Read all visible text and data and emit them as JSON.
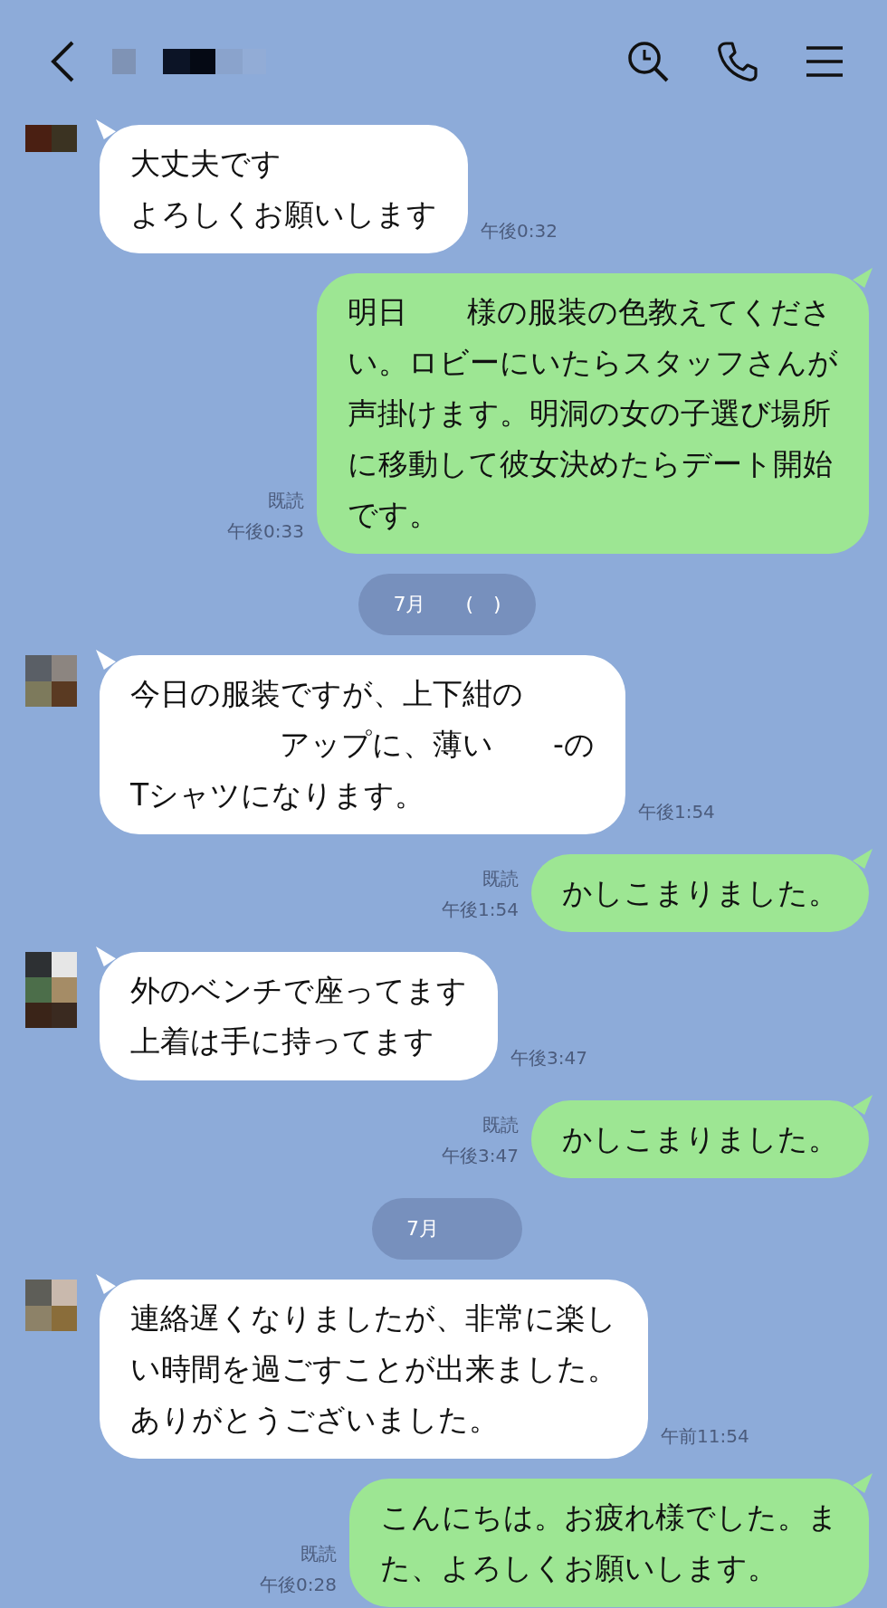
{
  "messages": [
    {
      "kind": "incoming",
      "lines": [
        "大丈夫です",
        "よろしくお願いします"
      ],
      "time": "午後0:32"
    },
    {
      "kind": "outgoing",
      "lines": [
        "明日　　様の服装の色教えてくださ",
        "い。ロビーにいたらスタッフさんが",
        "声掛けます。明洞の女の子選び場所",
        "に移動して彼女決めたらデート開始",
        "です。"
      ],
      "read_receipt": "既読",
      "time": "午後0:33"
    },
    {
      "kind": "date",
      "text": "7月　　(　)"
    },
    {
      "kind": "incoming",
      "lines": [
        "今日の服装ですが、上下紺の",
        "　　　　　アップに、薄い　　-の",
        "Tシャツになります。"
      ],
      "time": "午後1:54"
    },
    {
      "kind": "outgoing",
      "lines": [
        "かしこまりました。"
      ],
      "read_receipt": "既読",
      "time": "午後1:54"
    },
    {
      "kind": "incoming",
      "lines": [
        "外のベンチで座ってます",
        "上着は手に持ってます"
      ],
      "time": "午後3:47"
    },
    {
      "kind": "outgoing",
      "lines": [
        "かしこまりました。"
      ],
      "read_receipt": "既読",
      "time": "午後3:47"
    },
    {
      "kind": "date",
      "text": "7月"
    },
    {
      "kind": "incoming",
      "lines": [
        "連絡遅くなりましたが、非常に楽し",
        "い時間を過ごすことが出来ました。",
        "ありがとうございました。"
      ],
      "time": "午前11:54"
    },
    {
      "kind": "outgoing",
      "lines": [
        "こんにちは。お疲れ様でした。ま",
        "た、よろしくお願いします。"
      ],
      "read_receipt": "既読",
      "time": "午後0:28"
    }
  ]
}
